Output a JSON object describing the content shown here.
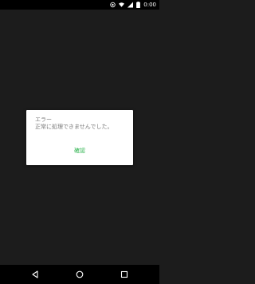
{
  "status_bar": {
    "time": "0:00",
    "icons": [
      "sync-icon",
      "wifi-icon",
      "signal-icon",
      "battery-icon"
    ]
  },
  "dialog": {
    "title": "エラー",
    "message": "正常に処理できませんでした。",
    "confirm_label": "確認"
  },
  "nav_bar": {
    "icons": [
      "back-icon",
      "home-icon",
      "recent-apps-icon"
    ]
  },
  "colors": {
    "background": "#1c1c1c",
    "dialog": "#ffffff",
    "text": "#7a7a7a",
    "accent": "#2bb24c"
  }
}
